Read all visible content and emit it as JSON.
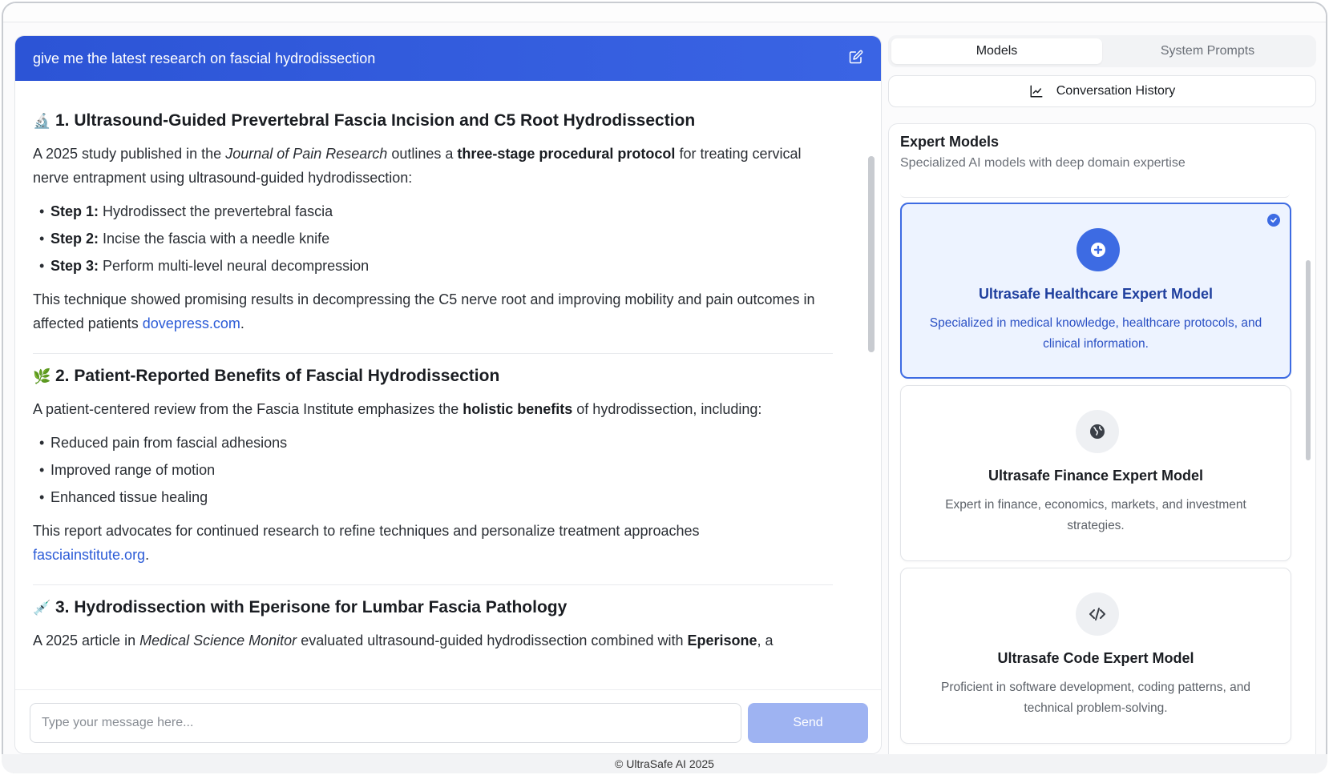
{
  "chat": {
    "title": "give me the latest research on fascial hydrodissection",
    "sections": [
      {
        "emoji": "🔬",
        "heading": "1. Ultrasound-Guided Prevertebral Fascia Incision and C5 Root Hydrodissection",
        "intro_a": "A 2025 study published in the ",
        "intro_italic": "Journal of Pain Research",
        "intro_b": " outlines a ",
        "intro_bold": "three-stage procedural protocol",
        "intro_c": " for treating cervical nerve entrapment using ultrasound-guided hydrodissection:",
        "steps": [
          {
            "label": "Step 1:",
            "text": " Hydrodissect the prevertebral fascia"
          },
          {
            "label": "Step 2:",
            "text": " Incise the fascia with a needle knife"
          },
          {
            "label": "Step 3:",
            "text": " Perform multi-level neural decompression"
          }
        ],
        "outro": "This technique showed promising results in decompressing the C5 nerve root and improving mobility and pain outcomes in affected patients ",
        "link": "dovepress.com"
      },
      {
        "emoji": "🌿",
        "heading": "2. Patient-Reported Benefits of Fascial Hydrodissection",
        "intro_a": "A patient-centered review from the Fascia Institute emphasizes the ",
        "intro_bold": "holistic benefits",
        "intro_c": " of hydrodissection, including:",
        "bullets": [
          "Reduced pain from fascial adhesions",
          "Improved range of motion",
          "Enhanced tissue healing"
        ],
        "outro": "This report advocates for continued research to refine techniques and personalize treatment approaches ",
        "link": "fasciainstitute.org"
      },
      {
        "emoji": "💉",
        "heading": "3. Hydrodissection with Eperisone for Lumbar Fascia Pathology",
        "intro_a": "A 2025 article in ",
        "intro_italic": "Medical Science Monitor",
        "intro_b": " evaluated ultrasound-guided hydrodissection combined with ",
        "intro_bold": "Eperisone",
        "intro_c": ", a"
      }
    ],
    "input_placeholder": "Type your message here...",
    "send_label": "Send"
  },
  "tabs": [
    {
      "label": "Models",
      "active": true
    },
    {
      "label": "System Prompts",
      "active": false
    }
  ],
  "history_label": "Conversation History",
  "models": {
    "title": "Expert Models",
    "subtitle": "Specialized AI models with deep domain expertise",
    "items": [
      {
        "name": "Ultrasafe Healthcare Expert Model",
        "desc": "Specialized in medical knowledge, healthcare protocols, and clinical information.",
        "icon": "plus-circle-icon",
        "selected": true
      },
      {
        "name": "Ultrasafe Finance Expert Model",
        "desc": "Expert in finance, economics, markets, and investment strategies.",
        "icon": "globe-icon",
        "selected": false
      },
      {
        "name": "Ultrasafe Code Expert Model",
        "desc": "Proficient in software development, coding patterns, and technical problem-solving.",
        "icon": "code-icon",
        "selected": false
      }
    ]
  },
  "footer": "© UltraSafe AI 2025",
  "colors": {
    "accent": "#3d6be3",
    "header": "#2c54d6",
    "link": "#2b5bd7"
  }
}
